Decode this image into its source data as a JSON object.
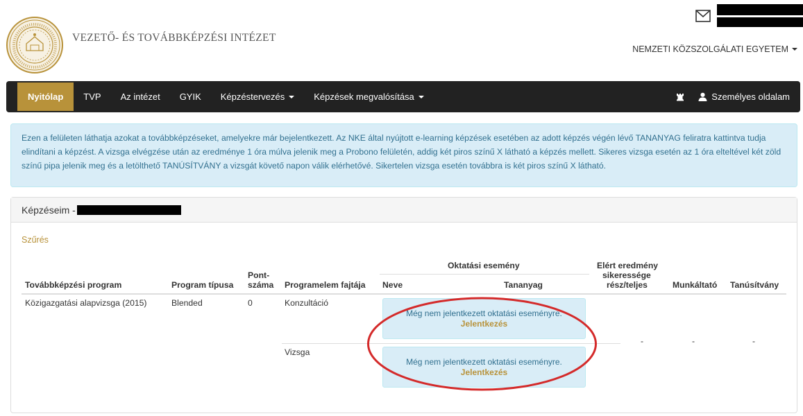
{
  "header": {
    "site_title": "VEZETŐ- ÉS TOVÁBBKÉPZÉSI INTÉZET",
    "university_link": "NEMZETI KÖZSZOLGÁLATI EGYETEM",
    "mail_icon": "envelope-icon"
  },
  "navbar": {
    "items": [
      {
        "label": "Nyitólap",
        "active": true
      },
      {
        "label": "TVP"
      },
      {
        "label": "Az intézet"
      },
      {
        "label": "GYIK"
      },
      {
        "label": "Képzéstervezés",
        "dropdown": true
      },
      {
        "label": "Képzések megvalósítása",
        "dropdown": true
      }
    ],
    "right": {
      "chess_icon": "chess-rook-icon",
      "user_label": "Személyes oldalam",
      "user_icon": "user-icon"
    },
    "colors": {
      "background": "#222222",
      "active": "#b8923a"
    }
  },
  "info": {
    "text": "Ezen a felületen láthatja azokat a továbbképzéseket, amelyekre már bejelentkezett. Az NKE által nyújtott e-learning képzések esetében az adott képzés végén lévő TANANYAG feliratra kattintva tudja elindítani a képzést. A vizsga elvégzése után az eredménye 1 óra múlva jelenik meg a Probono felületén, addig két piros színű X látható a képzés mellett. Sikeres vizsga esetén az 1 óra elteltével két zöld színű pipa jelenik meg és a letölthető TANÚSÍTVÁNY a vizsgát követő napon válik elérhetővé. Sikertelen vizsga esetén továbbra is két piros színű X látható."
  },
  "panel": {
    "heading": "Képzéseim -",
    "filter_link": "Szűrés",
    "table": {
      "headers": {
        "program": "Továbbképzési program",
        "type": "Program típusa",
        "points_line1": "Pont-",
        "points_line2": "száma",
        "element": "Programelem fajtája",
        "event_group": "Oktatási esemény",
        "event_name": "Neve",
        "event_material": "Tananyag",
        "result_line1": "Elért eredmény",
        "result_line2": "sikeressége",
        "result_line3": "rész/teljes",
        "employer": "Munkáltató",
        "certificate": "Tanúsítvány"
      },
      "row": {
        "program": "Közigazgatási alapvizsga (2015)",
        "type": "Blended",
        "points": "0",
        "result": "-",
        "employer": "-",
        "certificate": "-",
        "elements": [
          {
            "name": "Konzultáció",
            "message": "Még nem jelentkezett oktatási eseményre.",
            "link": "Jelentkezés"
          },
          {
            "name": "Vizsga",
            "message": "Még nem jelentkezett oktatási eseményre.",
            "link": "Jelentkezés"
          }
        ]
      }
    }
  }
}
